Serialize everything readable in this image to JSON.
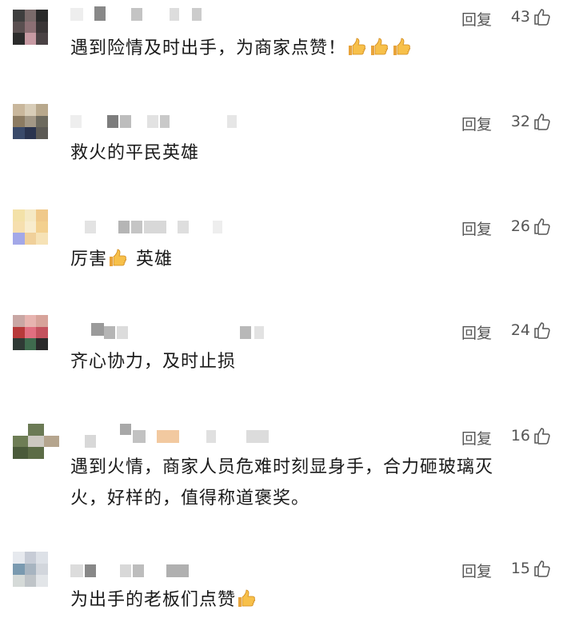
{
  "comments": [
    {
      "text": "遇到险情及时出手，为商家点赞！",
      "emojis": [
        "thumbs-up",
        "thumbs-up",
        "thumbs-up"
      ],
      "reply_label": "回复",
      "likes": "43"
    },
    {
      "text": "救火的平民英雄",
      "reply_label": "回复",
      "likes": "32"
    },
    {
      "text_before": "厉害",
      "text_after": " 英雄",
      "reply_label": "回复",
      "likes": "26"
    },
    {
      "text": "齐心协力，及时止损",
      "reply_label": "回复",
      "likes": "24"
    },
    {
      "text_line1": "遇到火情，商家人员危难时刻显身手，合力砸玻璃灭",
      "text_line2": "火，好样的，值得称道褒奖。",
      "reply_label": "回复",
      "likes": "16"
    },
    {
      "text": "为出手的老板们点赞",
      "reply_label": "回复",
      "likes": "15"
    }
  ],
  "icons": {
    "like": "thumbs-up-outline-icon",
    "emoji": "thumbs-up-emoji"
  },
  "colors": {
    "text": "#1a1a1a",
    "meta": "#555555",
    "emoji": "#f2b84b"
  }
}
